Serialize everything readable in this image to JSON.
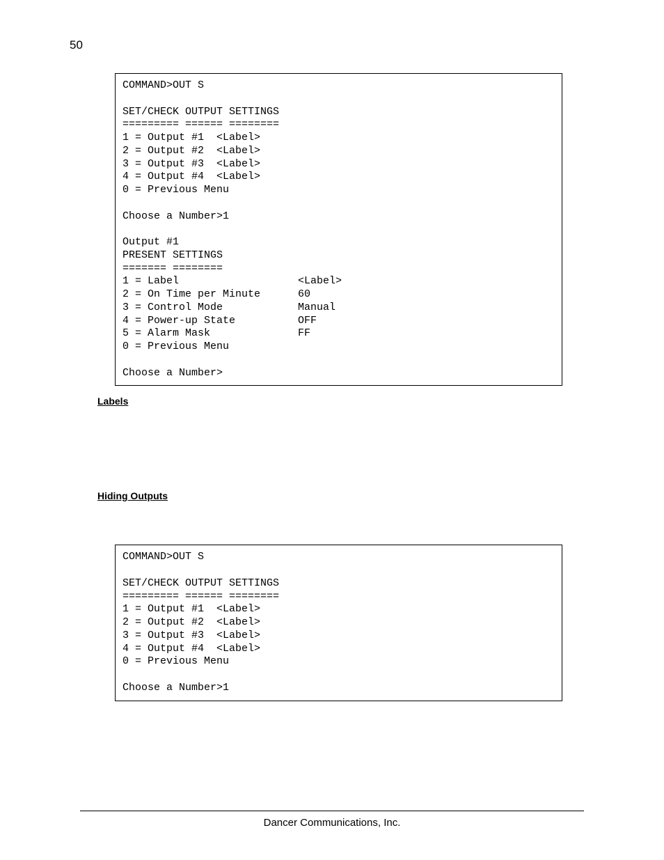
{
  "page_number": "50",
  "box1_text": "COMMAND>OUT S\n\nSET/CHECK OUTPUT SETTINGS\n========= ====== ========\n1 = Output #1  <Label>\n2 = Output #2  <Label>\n3 = Output #3  <Label>\n4 = Output #4  <Label>\n0 = Previous Menu\n\nChoose a Number>1\n\nOutput #1\nPRESENT SETTINGS\n======= ========\n1 = Label                   <Label>\n2 = On Time per Minute      60\n3 = Control Mode            Manual\n4 = Power-up State          OFF\n5 = Alarm Mask              FF\n0 = Previous Menu\n\nChoose a Number>",
  "heading_labels": "Labels",
  "heading_hiding": "Hiding Outputs ",
  "box2_text": "COMMAND>OUT S\n\nSET/CHECK OUTPUT SETTINGS\n========= ====== ========\n1 = Output #1  <Label>\n2 = Output #2  <Label>\n3 = Output #3  <Label>\n4 = Output #4  <Label>\n0 = Previous Menu\n\nChoose a Number>1",
  "footer": "Dancer Communications, Inc."
}
